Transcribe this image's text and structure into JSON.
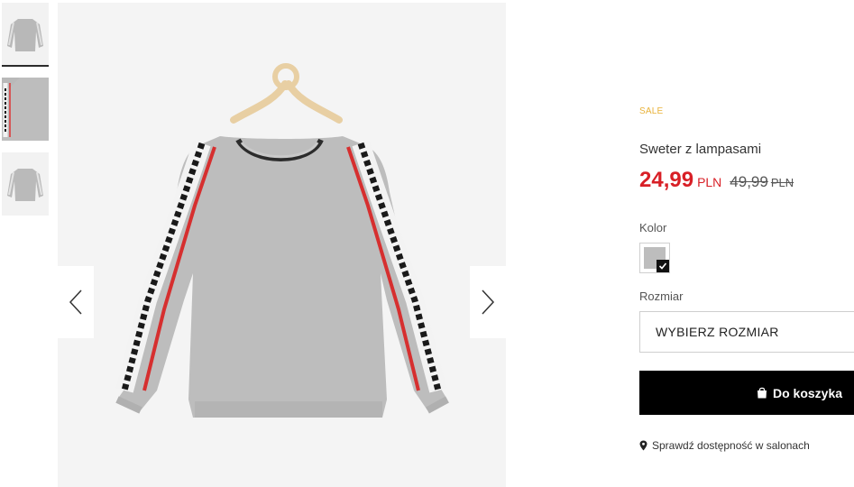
{
  "gallery": {
    "thumbnails": [
      {
        "name": "thumb-front",
        "active": true
      },
      {
        "name": "thumb-sleeve-detail",
        "active": false
      },
      {
        "name": "thumb-back",
        "active": false
      }
    ],
    "prev_icon": "chevron-left-icon",
    "next_icon": "chevron-right-icon"
  },
  "product": {
    "badge": "SALE",
    "title": "Sweter z lampasami",
    "price": "24,99",
    "price_currency": "PLN",
    "old_price": "49,99",
    "old_price_currency": "PLN",
    "color_label": "Kolor",
    "size_label": "Rozmiar",
    "size_select": "WYBIERZ ROZMIAR",
    "cart_button": "Do koszyka",
    "stock_link": "Sprawdź dostępność w salonach"
  },
  "colors": {
    "sale": "#e8b23a",
    "price": "#d81f26",
    "button": "#000000"
  }
}
